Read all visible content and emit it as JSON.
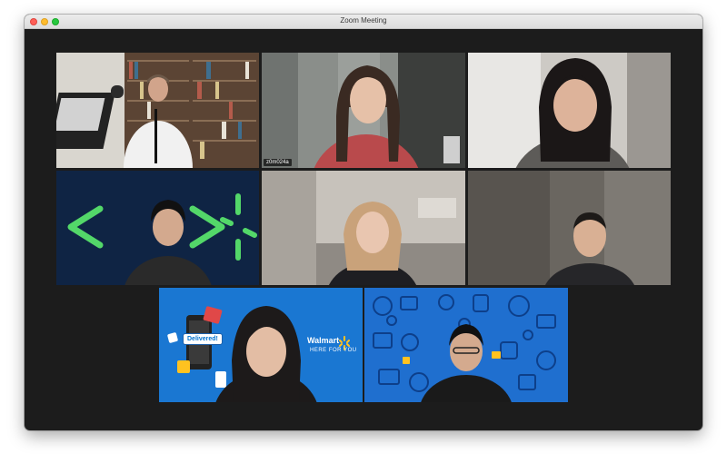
{
  "window": {
    "title": "Zoom Meeting"
  },
  "participants": [
    {
      "id": "p1",
      "name_tag": "",
      "background": "bookshelf-office"
    },
    {
      "id": "p2",
      "name_tag": "z0m024a",
      "background": "room",
      "active_speaker": true
    },
    {
      "id": "p3",
      "name_tag": "",
      "background": "bright-room"
    },
    {
      "id": "p4",
      "name_tag": "",
      "background": "navy-brand"
    },
    {
      "id": "p5",
      "name_tag": "",
      "background": "living-room"
    },
    {
      "id": "p6",
      "name_tag": "",
      "background": "dim-room"
    },
    {
      "id": "p7",
      "name_tag": "",
      "background": "walmart-blue",
      "overlay": {
        "brand": "Walmart",
        "tagline": "HERE FOR YOU",
        "badge": "Delivered!"
      }
    },
    {
      "id": "p8",
      "name_tag": "",
      "background": "walmart-blue-illustrated"
    }
  ],
  "colors": {
    "accent_speaker": "#c8e06a",
    "walmart_blue": "#1a77d2",
    "walmart_spark": "#ffc220",
    "brand_green": "#53d769"
  }
}
